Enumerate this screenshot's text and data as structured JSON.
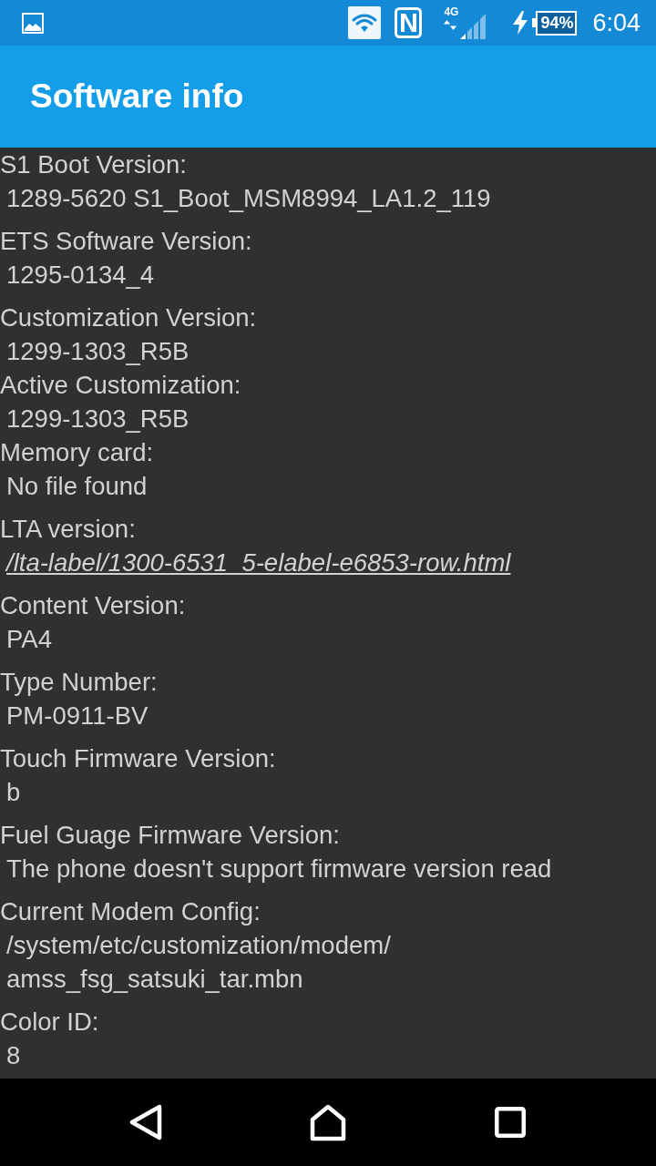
{
  "status_bar": {
    "network_type": "4G",
    "battery": "94%",
    "time": "6:04"
  },
  "app_bar": {
    "title": "Software info"
  },
  "items": [
    {
      "label": "S1 Boot Version:",
      "kind": "text",
      "lines": [
        "1289-5620 S1_Boot_MSM8994_LA1.2_119"
      ]
    },
    {
      "label": "ETS Software Version:",
      "kind": "text",
      "lines": [
        "1295-0134_4"
      ]
    },
    {
      "label": "Customization Version:",
      "kind": "text",
      "lines": [
        "1299-1303_R5B"
      ]
    },
    {
      "label": "Active Customization:",
      "kind": "text",
      "lines": [
        "1299-1303_R5B"
      ]
    },
    {
      "label": "Memory card:",
      "kind": "text",
      "lines": [
        "No file found"
      ]
    },
    {
      "label": "LTA version:",
      "kind": "link",
      "lines": [
        "/lta-label/1300-6531_5-elabel-e6853-row.html"
      ]
    },
    {
      "label": "Content Version:",
      "kind": "text",
      "lines": [
        "PA4"
      ]
    },
    {
      "label": "Type Number:",
      "kind": "text",
      "lines": [
        "PM-0911-BV"
      ]
    },
    {
      "label": "Touch Firmware Version:",
      "kind": "text",
      "lines": [
        "b"
      ]
    },
    {
      "label": "Fuel Guage Firmware Version:",
      "kind": "text",
      "lines": [
        "The phone doesn't support firmware version read"
      ]
    },
    {
      "label": "Current Modem Config:",
      "kind": "text",
      "lines": [
        "/system/etc/customization/modem/",
        "amss_fsg_satsuki_tar.mbn"
      ]
    },
    {
      "label": "Color ID:",
      "kind": "text",
      "lines": [
        "8"
      ]
    }
  ]
}
